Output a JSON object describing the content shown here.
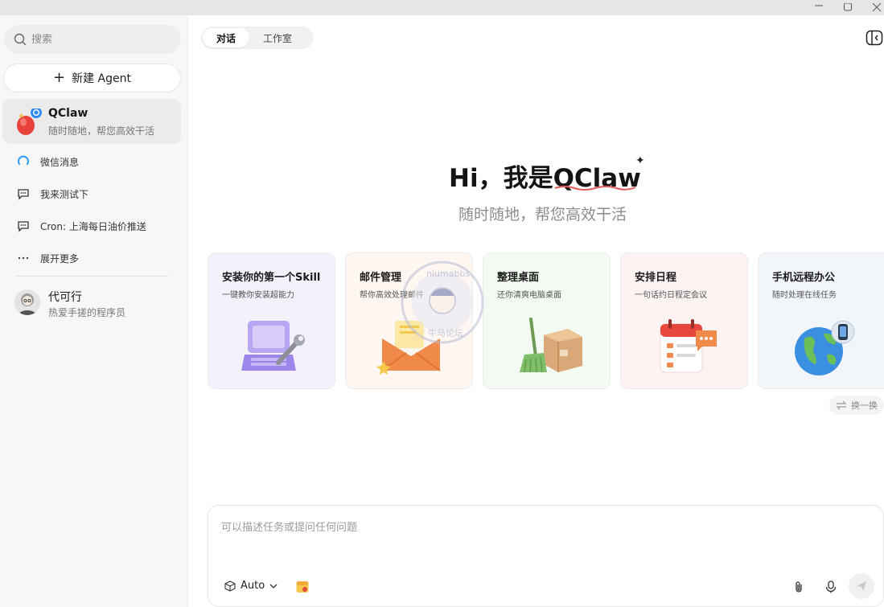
{
  "sidebar": {
    "search_placeholder": "搜索",
    "new_agent_label": "新建 Agent",
    "agent": {
      "name": "QClaw",
      "description": "随时随地，帮您高效干活"
    },
    "items": [
      {
        "label": "微信消息",
        "icon": "wechat-ring-icon"
      },
      {
        "label": "我来测试下",
        "icon": "chat-bubble-icon"
      },
      {
        "label": "Cron: 上海每日油价推送",
        "icon": "chat-bubble-icon"
      },
      {
        "label": "展开更多",
        "icon": "more-dots-icon"
      }
    ],
    "user": {
      "name": "代可行",
      "description": "热爱手搓的程序员"
    }
  },
  "header": {
    "tabs": [
      {
        "label": "对话",
        "active": true
      },
      {
        "label": "工作室",
        "active": false
      }
    ]
  },
  "hero": {
    "greeting_prefix": "Hi，我是",
    "greeting_name": "QClaw",
    "subtitle": "随时随地，帮您高效干活"
  },
  "cards": [
    {
      "title": "安装你的第一个Skill",
      "description": "一键教你安装超能力",
      "icon": "laptop-wrench-icon",
      "bg": "#f3f1fc"
    },
    {
      "title": "邮件管理",
      "description": "帮你高效处理邮件",
      "icon": "mail-envelope-icon",
      "bg": "#fdf6f1"
    },
    {
      "title": "整理桌面",
      "description": "还你清爽电脑桌面",
      "icon": "broom-box-icon",
      "bg": "#f3faf1"
    },
    {
      "title": "安排日程",
      "description": "一句话约日程定会议",
      "icon": "calendar-chat-icon",
      "bg": "#fdf3f3"
    },
    {
      "title": "手机远程办公",
      "description": "随时处理在线任务",
      "icon": "globe-phone-icon",
      "bg": "#f2f6fb"
    }
  ],
  "refresh_label": "换一换",
  "watermark": {
    "text_top": "niumabbs",
    "text_bottom": "牛马论坛"
  },
  "composer": {
    "placeholder": "可以描述任务或提问任何问题",
    "model_label": "Auto"
  }
}
